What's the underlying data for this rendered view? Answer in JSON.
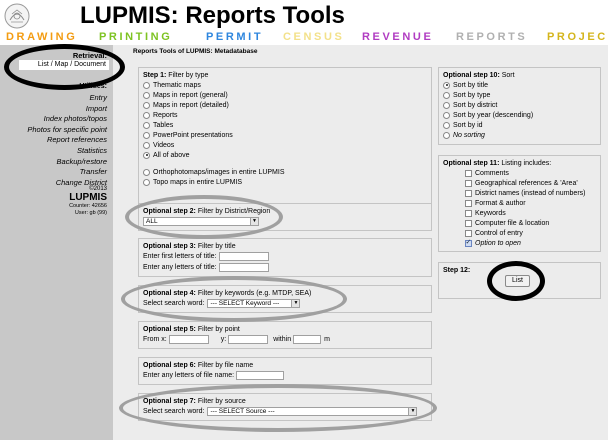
{
  "app": {
    "title": "LUPMIS: Reports Tools"
  },
  "nav": {
    "items": [
      {
        "label": "DRAWING",
        "color": "#f39c12"
      },
      {
        "label": "PRINTING",
        "color": "#7ec322"
      },
      {
        "label": "PERMIT",
        "color": "#2e86de"
      },
      {
        "label": "CENSUS",
        "color": "#f3e18a"
      },
      {
        "label": "REVENUE",
        "color": "#b13cc2"
      },
      {
        "label": "REPORTS",
        "color": "#b0b0b0"
      },
      {
        "label": "PROJEC",
        "color": "#d4b51c"
      }
    ]
  },
  "sidebar": {
    "heading": "Retrieval:",
    "active": "List / Map / Document",
    "subheading": "Utilities:",
    "links": [
      "Entry",
      "Import",
      "Index photos/topos",
      "Photos for specific point",
      "Report references",
      "Statistics",
      "Backup/restore",
      "Transfer",
      "Change District"
    ],
    "footer": {
      "year": "©2013",
      "brand": "LUPMIS",
      "counter": "Counter: 42656",
      "user": "User: gb (99)"
    }
  },
  "main": {
    "title": "Reports Tools of LUPMIS: Metadatabase",
    "step1": {
      "head": "Step 1:",
      "desc": "Filter by type",
      "options": [
        {
          "label": "Thematic maps",
          "checked": false
        },
        {
          "label": "Maps in report (general)",
          "checked": false
        },
        {
          "label": "Maps in report (detailed)",
          "checked": false
        },
        {
          "label": "Reports",
          "checked": false
        },
        {
          "label": "Tables",
          "checked": false
        },
        {
          "label": "PowerPoint presentations",
          "checked": false
        },
        {
          "label": "Videos",
          "checked": false
        },
        {
          "label": "All of above",
          "checked": true
        }
      ],
      "options2": [
        {
          "label": "Orthophotomaps/images in entire LUPMIS",
          "checked": false
        },
        {
          "label": "Topo maps in entire LUPMIS",
          "checked": false
        }
      ]
    },
    "step2": {
      "head": "Optional step 2:",
      "desc": "Filter by District/Region",
      "select_value": "ALL"
    },
    "step3": {
      "head": "Optional step 3:",
      "desc": "Filter by title",
      "first_label": "Enter first letters of title:",
      "any_label": "Enter any letters of title:"
    },
    "step4": {
      "head": "Optional step 4:",
      "desc": "Filter by keywords (e.g. MTDP, SEA)",
      "label": "Select search word:",
      "select_value": "--- SELECT Keyword ---"
    },
    "step5": {
      "head": "Optional step 5:",
      "desc": "Filter by point",
      "from": "From x:",
      "y": "y:",
      "within": "within",
      "unit": "m"
    },
    "step6": {
      "head": "Optional step 6:",
      "desc": "Filter by file name",
      "label": "Enter any letters of file name:"
    },
    "step7": {
      "head": "Optional step 7:",
      "desc": "Filter by source",
      "label": "Select search word:",
      "select_value": "--- SELECT Source ---"
    },
    "step10": {
      "head": "Optional step 10:",
      "desc": "Sort",
      "options": [
        {
          "label": "Sort by title",
          "checked": true,
          "italic": false
        },
        {
          "label": "Sort by type",
          "checked": false,
          "italic": false
        },
        {
          "label": "Sort by district",
          "checked": false,
          "italic": false
        },
        {
          "label": "Sort by year (descending)",
          "checked": false,
          "italic": false
        },
        {
          "label": "Sort by id",
          "checked": false,
          "italic": false
        },
        {
          "label": "No sorting",
          "checked": false,
          "italic": true
        }
      ]
    },
    "step11": {
      "head": "Optional step 11:",
      "desc": "Listing includes:",
      "options": [
        {
          "label": "Comments",
          "checked": false,
          "italic": false
        },
        {
          "label": "Geographical references & 'Area'",
          "checked": false,
          "italic": false
        },
        {
          "label": "District names (instead of numbers)",
          "checked": false,
          "italic": false
        },
        {
          "label": "Format & author",
          "checked": false,
          "italic": false
        },
        {
          "label": "Keywords",
          "checked": false,
          "italic": false
        },
        {
          "label": "Computer file & location",
          "checked": false,
          "italic": false
        },
        {
          "label": "Control of entry",
          "checked": false,
          "italic": false
        },
        {
          "label": "Option to open",
          "checked": true,
          "italic": true
        }
      ]
    },
    "step12": {
      "head": "Step 12:",
      "button": "List"
    }
  },
  "colors": {
    "sidebar": "#c8c8c8",
    "main": "#ececec",
    "highlight_black": "#000000",
    "highlight_gray": "#a0a0a0"
  }
}
